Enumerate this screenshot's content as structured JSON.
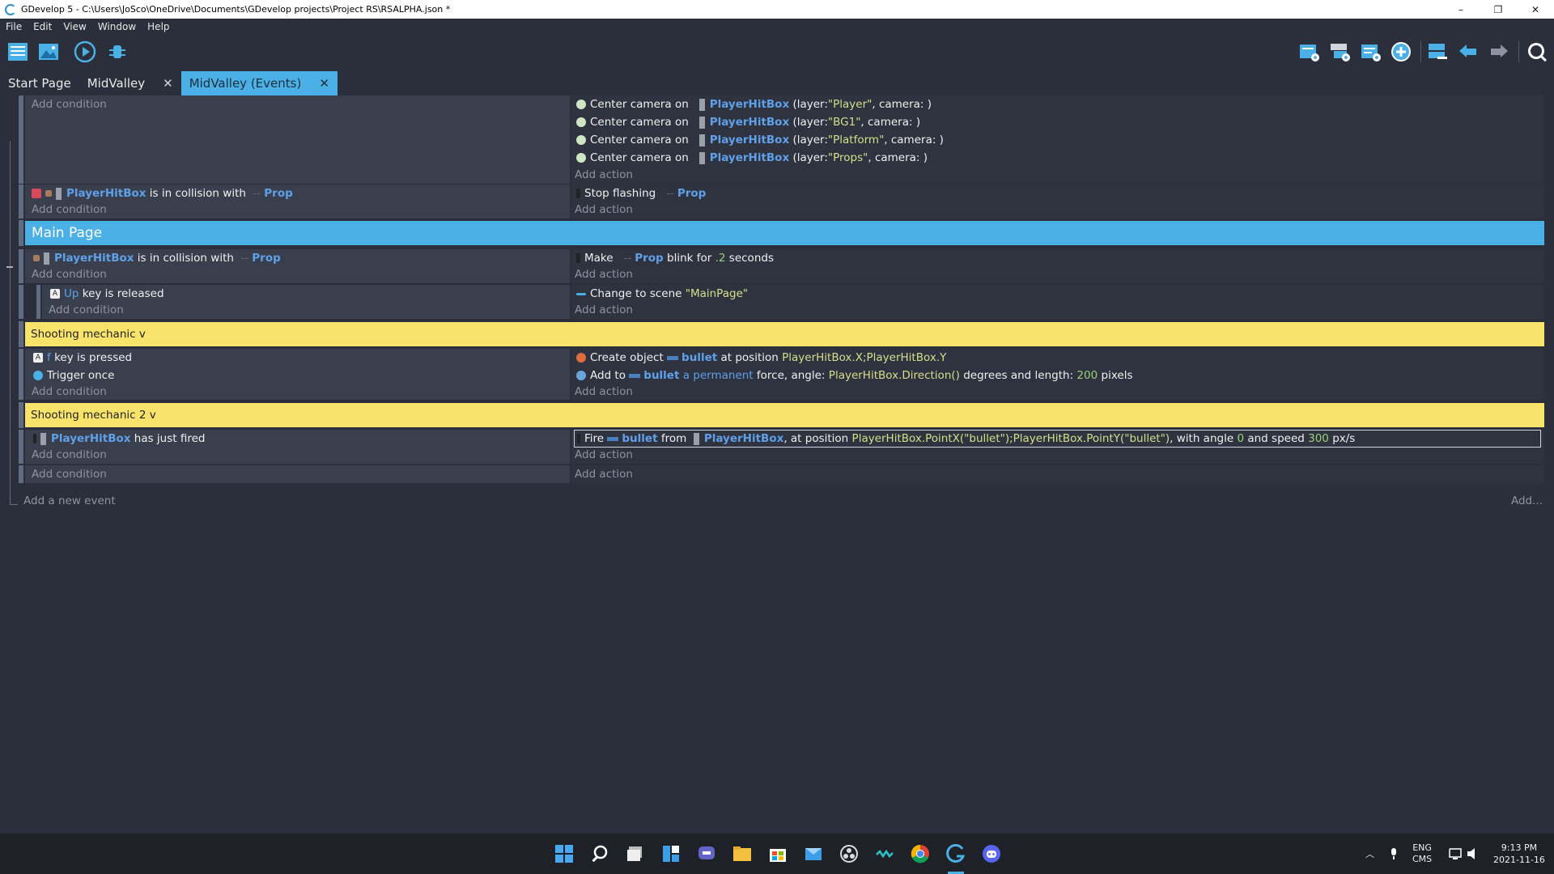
{
  "window": {
    "title": "GDevelop 5 - C:\\Users\\JoSco\\OneDrive\\Documents\\GDevelop projects\\Project RS\\RSALPHA.json *",
    "minimize": "–",
    "maximize": "❐",
    "close": "✕"
  },
  "menu": [
    "File",
    "Edit",
    "View",
    "Window",
    "Help"
  ],
  "toolbar": {
    "left": [
      "project-manager-icon",
      "scene-icon",
      "preview-play-icon",
      "debug-icon"
    ],
    "right": [
      "add-event-icon",
      "add-subevent-icon",
      "add-comment-icon",
      "add-other-icon",
      "delete-event-icon",
      "undo-icon",
      "redo-icon",
      "search-icon"
    ]
  },
  "tabs": [
    {
      "label": "Start Page",
      "closable": false
    },
    {
      "label": "MidValley",
      "closable": true
    },
    {
      "label": "MidValley (Events)",
      "closable": true,
      "active": true
    }
  ],
  "close_glyph": "✕",
  "add_condition": "Add condition",
  "add_action": "Add action",
  "events": {
    "e1": {
      "actions": [
        {
          "pre": "Center camera on",
          "obj": "PlayerHitBox",
          "a": "(layer: ",
          "s": "\"Player\"",
          "b": ", camera: )"
        },
        {
          "pre": "Center camera on",
          "obj": "PlayerHitBox",
          "a": "(layer: ",
          "s": "\"BG1\"",
          "b": ", camera: )"
        },
        {
          "pre": "Center camera on",
          "obj": "PlayerHitBox",
          "a": "(layer: ",
          "s": "\"Platform\"",
          "b": ", camera: )"
        },
        {
          "pre": "Center camera on",
          "obj": "PlayerHitBox",
          "a": "(layer: ",
          "s": "\"Props\"",
          "b": ", camera: )"
        }
      ]
    },
    "e2": {
      "cond": {
        "obj": "PlayerHitBox",
        "text": "is in collision with",
        "obj2": "Prop"
      },
      "act": {
        "text": "Stop flashing",
        "obj": "Prop"
      }
    },
    "comment": "Main Page",
    "e3": {
      "cond": {
        "obj": "PlayerHitBox",
        "text": "is in collision with",
        "obj2": "Prop"
      },
      "act": {
        "pre": "Make",
        "obj": "Prop",
        "mid": "blink for",
        "num": ".2",
        "post": "seconds"
      }
    },
    "e3sub": {
      "cond": {
        "key": "Up",
        "text": "key is released"
      },
      "act": {
        "text": "Change to scene",
        "str": "\"MainPage\""
      }
    },
    "group1": "Shooting mechanic v",
    "e4": {
      "cond1": {
        "key": "f",
        "text": "key is pressed"
      },
      "cond2": {
        "text": "Trigger once"
      },
      "act1": {
        "pre": "Create object",
        "obj": "bullet",
        "mid": "at position",
        "expr": "PlayerHitBox.X;PlayerHitBox.Y"
      },
      "act2": {
        "pre": "Add to",
        "obj": "bullet",
        "kw": "a permanent",
        "mid": "force, angle:",
        "expr": "PlayerHitBox.Direction()",
        "mid2": "degrees and length:",
        "num": "200",
        "post": "pixels"
      }
    },
    "group2": "Shooting mechanic 2 v",
    "e5": {
      "cond": {
        "obj": "PlayerHitBox",
        "text": "has just fired"
      },
      "act": {
        "pre": "Fire",
        "obj": "bullet",
        "mid": "from",
        "obj2": "PlayerHitBox",
        "mid2": ", at position",
        "expr": "PlayerHitBox.PointX(\"bullet\");PlayerHitBox.PointY(\"bullet\")",
        "mid3": ", with angle",
        "num1": "0",
        "mid4": "and speed",
        "num2": "300",
        "post": "px/s"
      }
    },
    "add_event": "Add a new event",
    "add_more": "Add..."
  },
  "taskbar": {
    "apps": [
      "windows-start-icon",
      "search-icon",
      "task-view-icon",
      "widgets-icon",
      "teams-chat-icon",
      "file-explorer-icon",
      "store-icon",
      "mail-icon",
      "obs-icon",
      "wave-app-icon",
      "chrome-icon",
      "gdevelop-icon",
      "discord-icon"
    ],
    "lang": "ENG",
    "ime": "CMS",
    "time": "9:13 PM",
    "date": "2021-11-16"
  }
}
